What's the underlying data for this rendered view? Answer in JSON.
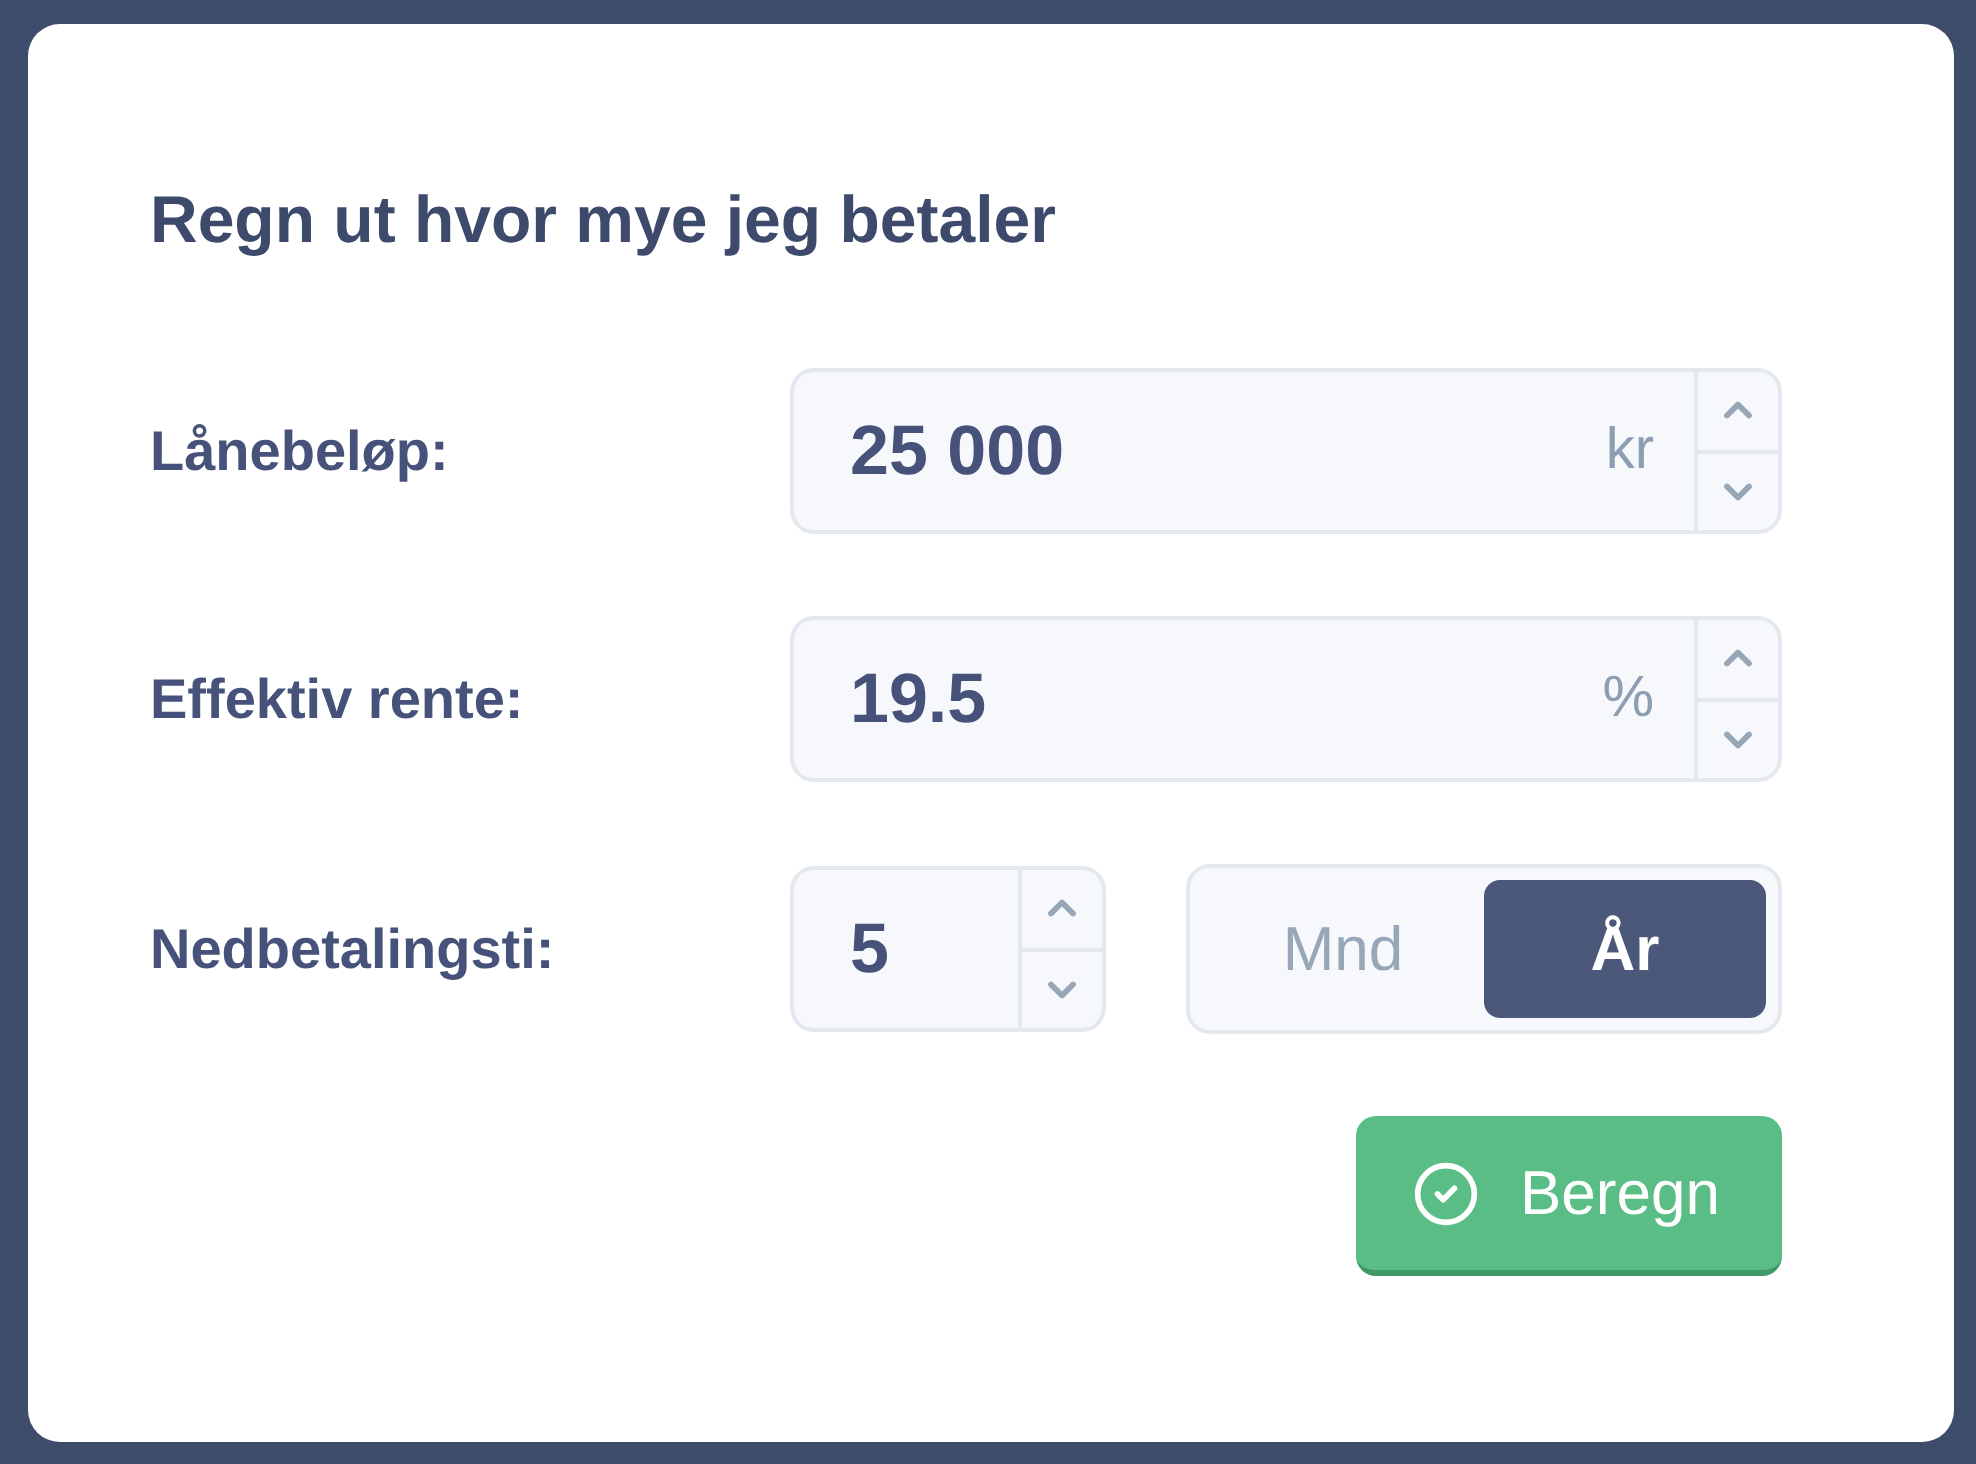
{
  "title": "Regn ut hvor mye jeg betaler",
  "fields": [
    {
      "label": "Lånebeløp:",
      "value": "25 000",
      "unit": "kr"
    },
    {
      "label": "Effektiv rente:",
      "value": "19.5",
      "unit": "%"
    }
  ],
  "term": {
    "label": "Nedbetalingsti:",
    "value": "5",
    "periods": [
      {
        "label": "Mnd",
        "selected": false
      },
      {
        "label": "År",
        "selected": true
      }
    ]
  },
  "button": {
    "label": "Beregn"
  }
}
